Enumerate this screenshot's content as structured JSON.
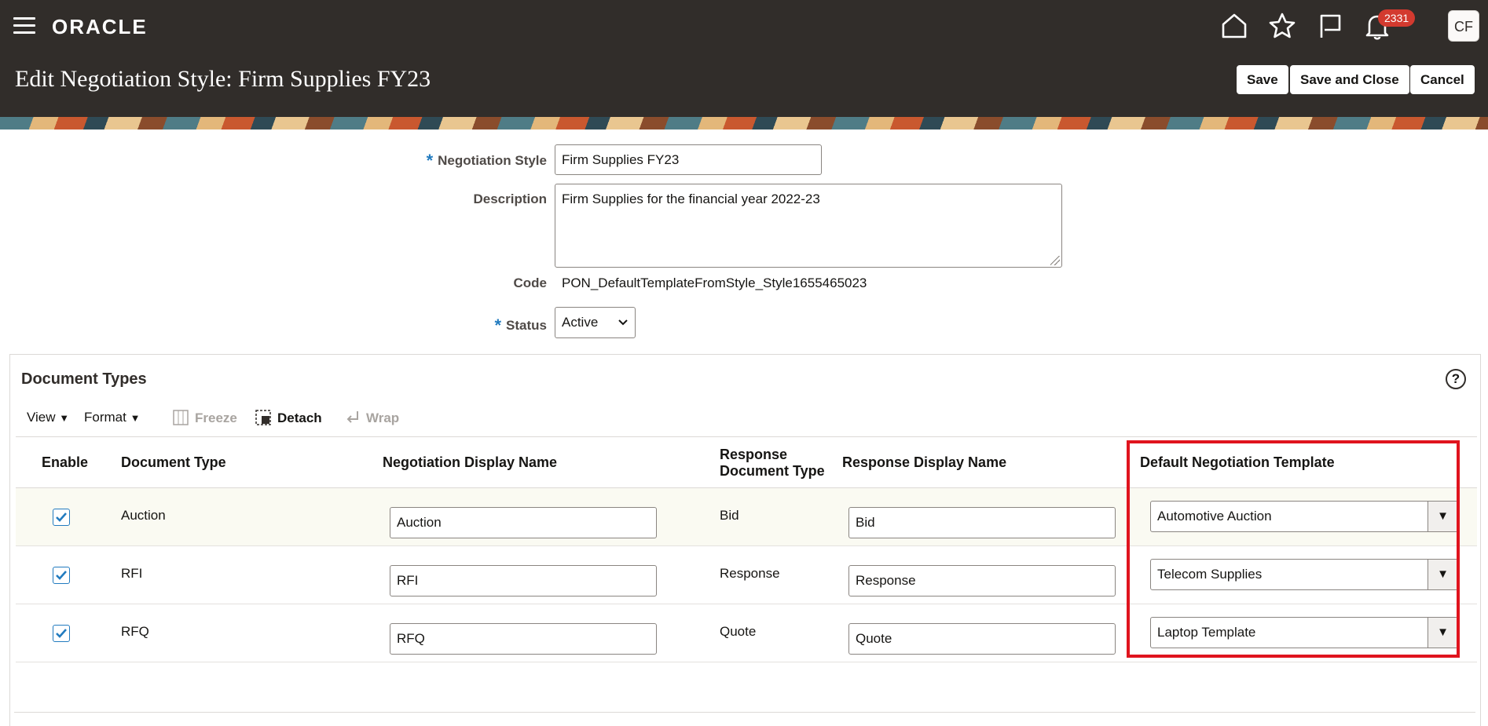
{
  "header": {
    "logo": "ORACLE",
    "notification_count": "2331",
    "avatar_initials": "CF",
    "page_title": "Edit Negotiation Style: Firm Supplies FY23",
    "buttons": {
      "save": "Save",
      "save_close": "Save and Close",
      "cancel": "Cancel"
    }
  },
  "form": {
    "style_label": "Negotiation Style",
    "style_value": "Firm Supplies FY23",
    "description_label": "Description",
    "description_value": "Firm Supplies for the financial year 2022-23",
    "code_label": "Code",
    "code_value": "PON_DefaultTemplateFromStyle_Style1655465023",
    "status_label": "Status",
    "status_value": "Active",
    "required_mark": "*"
  },
  "panel": {
    "title": "Document Types",
    "toolbar": {
      "view": "View",
      "format": "Format",
      "freeze": "Freeze",
      "detach": "Detach",
      "wrap": "Wrap"
    },
    "columns": {
      "enable": "Enable",
      "document_type": "Document Type",
      "negotiation_display_name": "Negotiation Display Name",
      "response_document_type_1": "Response",
      "response_document_type_2": "Document Type",
      "response_display_name": "Response Display Name",
      "default_template": "Default Negotiation Template"
    },
    "rows": [
      {
        "enabled": true,
        "document_type": "Auction",
        "negotiation_display_name": "Auction",
        "response_document_type": "Bid",
        "response_display_name": "Bid",
        "default_template": "Automotive Auction"
      },
      {
        "enabled": true,
        "document_type": "RFI",
        "negotiation_display_name": "RFI",
        "response_document_type": "Response",
        "response_display_name": "Response",
        "default_template": "Telecom Supplies"
      },
      {
        "enabled": true,
        "document_type": "RFQ",
        "negotiation_display_name": "RFQ",
        "response_document_type": "Quote",
        "response_display_name": "Quote",
        "default_template": "Laptop Template"
      }
    ]
  },
  "colors": {
    "header_bg": "#312d2a",
    "accent": "#227bbf",
    "highlight": "#e0141e",
    "badge": "#d33a2f"
  }
}
